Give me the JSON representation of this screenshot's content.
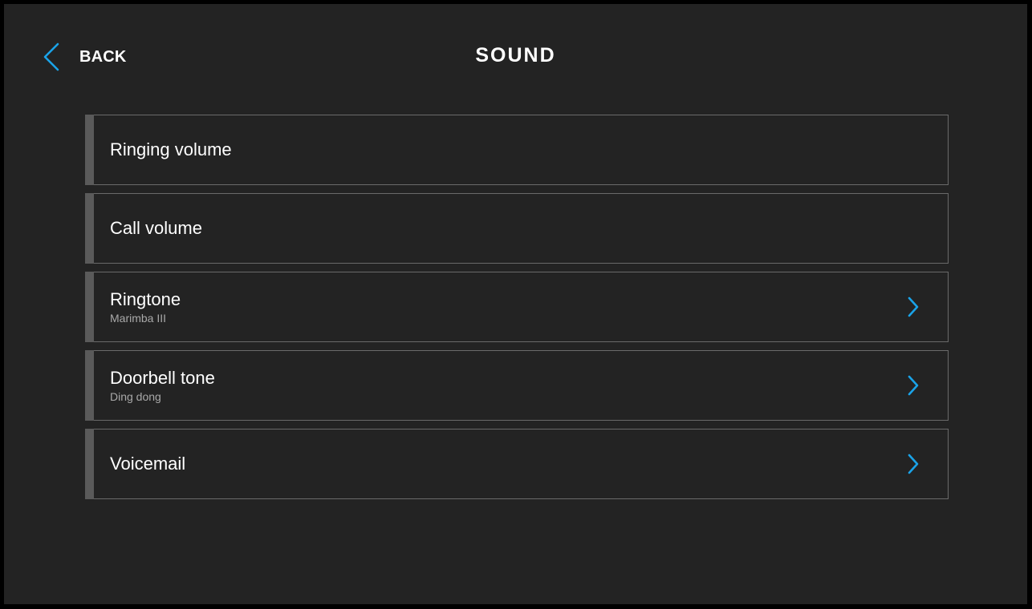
{
  "header": {
    "back_label": "BACK",
    "title": "SOUND"
  },
  "colors": {
    "accent": "#1aa3e8",
    "background": "#232323",
    "row_border": "#6a6a6a",
    "row_bar": "#5a5a5a"
  },
  "icons": {
    "back": "chevron-left-icon",
    "row_arrow": "chevron-right-icon"
  },
  "items": [
    {
      "label": "Ringing volume",
      "sub": ""
    },
    {
      "label": "Call volume",
      "sub": ""
    },
    {
      "label": "Ringtone",
      "sub": "Marimba III"
    },
    {
      "label": "Doorbell tone",
      "sub": "Ding dong"
    },
    {
      "label": "Voicemail",
      "sub": ""
    }
  ]
}
